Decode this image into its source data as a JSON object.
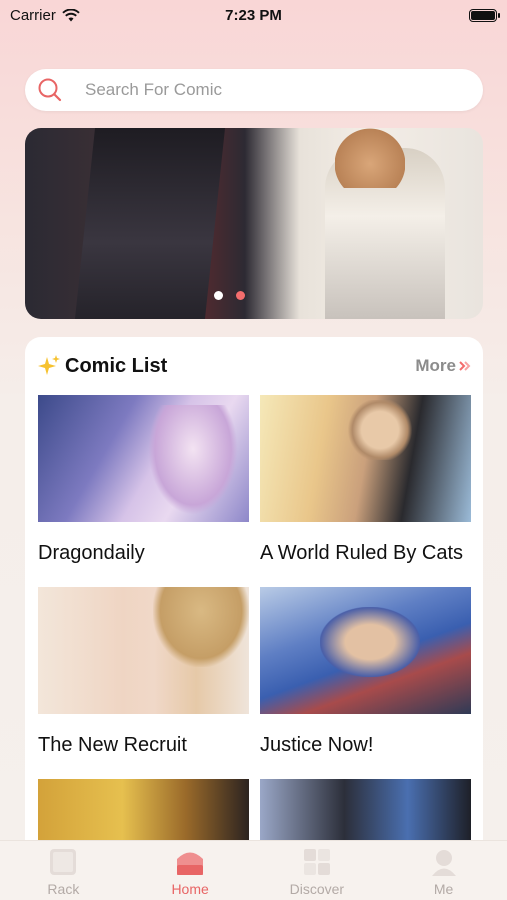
{
  "status_bar": {
    "carrier": "Carrier",
    "time": "7:23 PM"
  },
  "search": {
    "placeholder": "Search For Comic",
    "icon": "search-icon"
  },
  "banner": {
    "pages": 2,
    "active_page": 2
  },
  "comic_list": {
    "title": "Comic List",
    "more_label": "More",
    "items": [
      {
        "title": "Dragondaily"
      },
      {
        "title": "A World Ruled By Cats"
      },
      {
        "title": "The New Recruit"
      },
      {
        "title": "Justice Now!"
      },
      {
        "title": ""
      },
      {
        "title": ""
      }
    ]
  },
  "tab_bar": {
    "tabs": [
      {
        "label": "Rack",
        "icon": "book-icon",
        "active": false
      },
      {
        "label": "Home",
        "icon": "home-icon",
        "active": true
      },
      {
        "label": "Discover",
        "icon": "grid-icon",
        "active": false
      },
      {
        "label": "Me",
        "icon": "user-icon",
        "active": false
      }
    ]
  },
  "colors": {
    "accent": "#f36d6d",
    "tab_active": "#e86565",
    "tab_inactive": "#b3aaa6"
  }
}
